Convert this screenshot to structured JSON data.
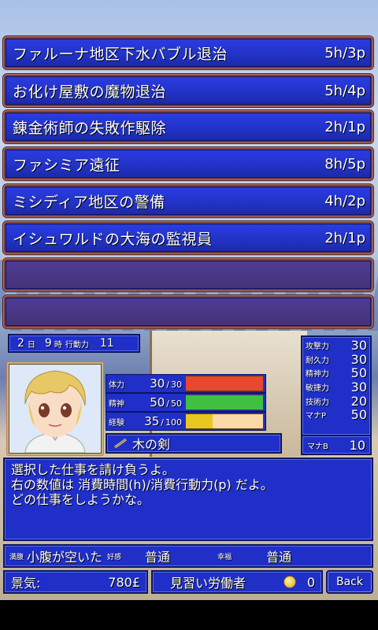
{
  "jobs": [
    {
      "name": "ファルーナ地区下水バブル退治",
      "cost": "5h/3p"
    },
    {
      "name": "お化け屋敷の魔物退治",
      "cost": "5h/4p"
    },
    {
      "name": "錬金術師の失敗作駆除",
      "cost": "2h/1p"
    },
    {
      "name": "ファシミア遠征",
      "cost": "8h/5p"
    },
    {
      "name": "ミシディア地区の警備",
      "cost": "4h/2p"
    },
    {
      "name": "イシュワルドの大海の監視員",
      "cost": "2h/1p"
    },
    {
      "name": "",
      "cost": ""
    },
    {
      "name": "",
      "cost": ""
    }
  ],
  "date": {
    "month": "2",
    "month_unit": "日",
    "hour": "9",
    "hour_unit": "時",
    "ap_label": "行動力",
    "ap": "11"
  },
  "gauges": [
    {
      "label": "体力",
      "value": "30",
      "max": "30",
      "fraction": 1.0,
      "color": "#e84830"
    },
    {
      "label": "精神",
      "value": "50",
      "max": "50",
      "fraction": 1.0,
      "color": "#40c040"
    },
    {
      "label": "経験",
      "value": "35",
      "max": "100",
      "fraction": 0.35,
      "color": "#e8c820"
    }
  ],
  "weapon": {
    "name": "木の剣",
    "icon": "sword-icon"
  },
  "stats": [
    {
      "label": "攻撃力",
      "value": "30"
    },
    {
      "label": "耐久力",
      "value": "30"
    },
    {
      "label": "精神力",
      "value": "50"
    },
    {
      "label": "敏捷力",
      "value": "30"
    },
    {
      "label": "技術力",
      "value": "20"
    },
    {
      "label": "マナP",
      "value": "50"
    }
  ],
  "mana_b": {
    "label": "マナB",
    "value": "10"
  },
  "message": {
    "line1": "選択した仕事を請け負うよ。",
    "line2": "右の数値は 消費時間(h)/消費行動力(p) だよ。",
    "line3": "どの仕事をしようかな。"
  },
  "status": {
    "hunger_label": "満腹",
    "hunger": "小腹が空いた",
    "favor_label": "好感",
    "favor": "普通",
    "happiness_label": "幸福",
    "happiness": "普通"
  },
  "economy": {
    "label": "景気:",
    "value": "780£"
  },
  "rank": {
    "title": "見習い労働者",
    "medals": "0",
    "icon": "medal-icon"
  },
  "back_label": "Back",
  "colors": {
    "panel_blue": "#1f2fc8",
    "frame_red": "#7a3d3c"
  }
}
